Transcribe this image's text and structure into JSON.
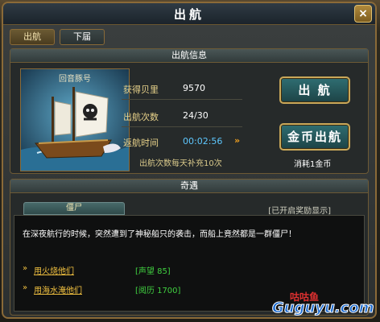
{
  "window": {
    "title": "出航",
    "close_label": "×"
  },
  "tabs": {
    "active": "出航",
    "inactive": "下届"
  },
  "voyage": {
    "header": "出航信息",
    "ship_name": "回音豚号",
    "stats": [
      {
        "label": "获得贝里",
        "value": "9570"
      },
      {
        "label": "出航次数",
        "value": "24/30"
      },
      {
        "label": "返航时间",
        "value": "00:02:56"
      }
    ],
    "note": "出航次数每天补充10次",
    "sail_button": "出 航",
    "gold_sail_button": "金币出航",
    "cost": "消耗1金币"
  },
  "encounter": {
    "header": "奇遇",
    "sub_tab": "僵尸",
    "reward_toggle": "[已开启奖励显示]",
    "story": "在深夜航行的时候，突然遭到了神秘船只的袭击，而船上竟然都是一群僵尸！",
    "options": [
      {
        "label": "用火烧他们",
        "reward": "[声望  85]"
      },
      {
        "label": "用海水淹他们",
        "reward": "[阅历  1700]"
      }
    ]
  },
  "watermark": {
    "cn": "咕咕鱼",
    "en": "Guguyu.com"
  },
  "colors": {
    "gold": "#e8d28a",
    "timer": "#5ec8ff",
    "reward": "#40d040",
    "link": "#f0c040"
  }
}
